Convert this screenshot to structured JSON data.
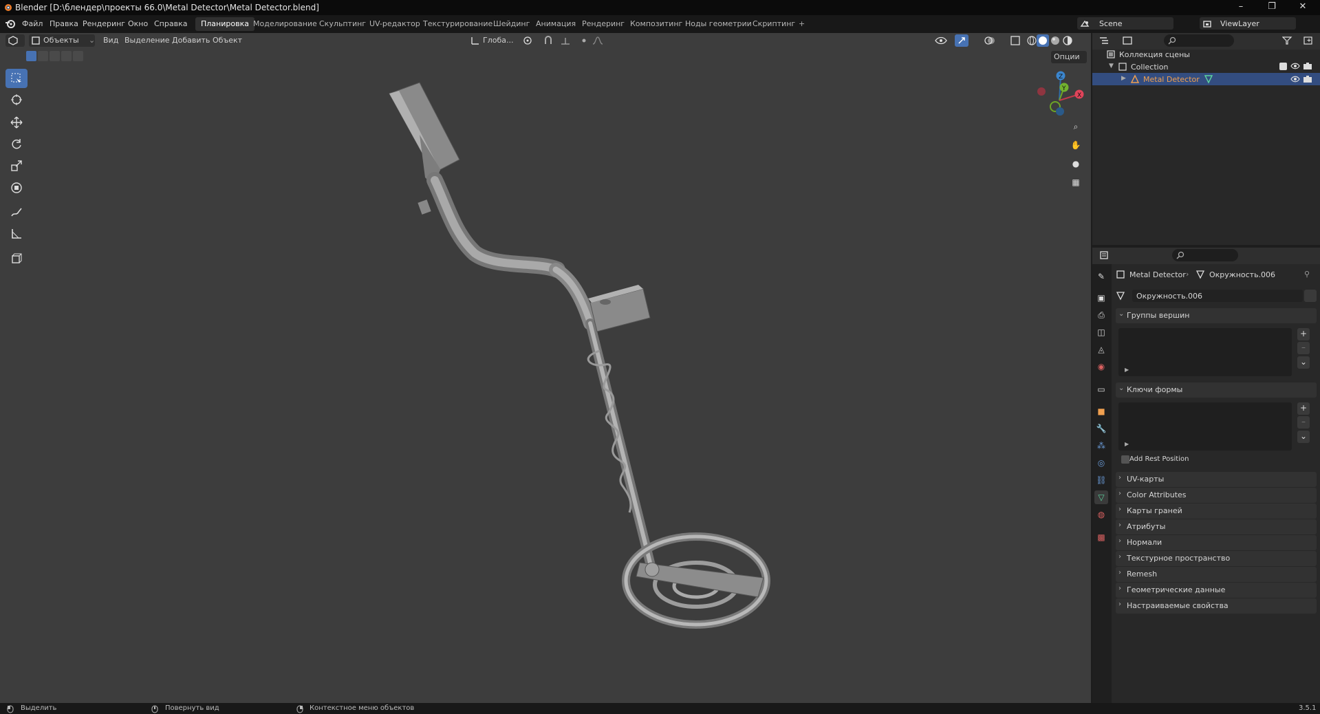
{
  "window": {
    "title": "Blender [D:\\блендер\\проекты 66.0\\Metal Detector\\Metal Detector.blend]",
    "minimize": "–",
    "maximize": "❐",
    "close": "✕"
  },
  "menu": {
    "items": [
      "Файл",
      "Правка",
      "Рендеринг",
      "Окно",
      "Справка"
    ],
    "workspaces": [
      "Планировка",
      "Моделирование",
      "Скульптинг",
      "UV-редактор",
      "Текстурирование",
      "Шейдинг",
      "Анимация",
      "Рендеринг",
      "Композитинг",
      "Ноды геометрии",
      "Скриптинг"
    ],
    "active_workspace": "Планировка",
    "add_tab": "+",
    "scene": "Scene",
    "view_layer": "ViewLayer"
  },
  "viewport_header": {
    "mode": "Объекты",
    "menus": [
      "Вид",
      "Выделение",
      "Добавить",
      "Объект"
    ],
    "orientation": "Глоба...",
    "options": "Опции"
  },
  "gizmo": {
    "z": "Z",
    "y": "Y",
    "x": "X"
  },
  "outliner": {
    "root": "Коллекция сцены",
    "collection": "Collection",
    "object": "Metal Detector"
  },
  "properties": {
    "breadcrumb_object": "Metal Detector",
    "breadcrumb_mesh": "Окружность.006",
    "mesh_name": "Окружность.006",
    "vertex_groups": "Группы вершин",
    "shape_keys": "Ключи формы",
    "add_rest_position": "Add Rest Position",
    "collapsed_panels": [
      "UV-карты",
      "Color Attributes",
      "Карты граней",
      "Атрибуты",
      "Нормали",
      "Текстурное пространство",
      "Remesh",
      "Геометрические данные",
      "Настраиваемые свойства"
    ]
  },
  "statusbar": {
    "select": "Выделить",
    "rotate": "Повернуть вид",
    "context": "Контекстное меню объектов",
    "version": "3.5.1"
  },
  "colors": {
    "accent": "#4772b3",
    "viewport_bg": "#3d3d3d",
    "selected_row": "#334d80",
    "object_orange": "#f0a050",
    "mesh_green": "#5dd5a0"
  }
}
